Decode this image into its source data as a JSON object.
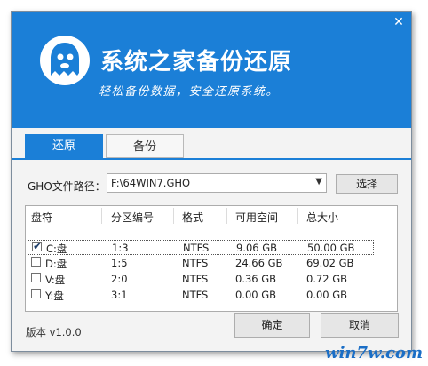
{
  "header": {
    "title": "系统之家备份还原",
    "subtitle": "轻松备份数据，安全还原系统。"
  },
  "tabs": [
    {
      "label": "还原",
      "active": true
    },
    {
      "label": "备份",
      "active": false
    }
  ],
  "path": {
    "label": "GHO文件路径：",
    "value": "F:\\64WIN7.GHO",
    "select_button": "选择"
  },
  "table": {
    "headers": [
      "盘符",
      "分区编号",
      "格式",
      "可用空间",
      "总大小"
    ],
    "rows": [
      {
        "drive": "C:盘",
        "partition": "1:3",
        "format": "NTFS",
        "free": "9.06 GB",
        "total": "50.00 GB",
        "checked": true
      },
      {
        "drive": "D:盘",
        "partition": "1:5",
        "format": "NTFS",
        "free": "24.66 GB",
        "total": "69.02 GB",
        "checked": false
      },
      {
        "drive": "V:盘",
        "partition": "2:0",
        "format": "NTFS",
        "free": "0.36 GB",
        "total": "0.72 GB",
        "checked": false
      },
      {
        "drive": "Y:盘",
        "partition": "3:1",
        "format": "NTFS",
        "free": "0.00 GB",
        "total": "0.00 GB",
        "checked": false
      }
    ]
  },
  "footer": {
    "version": "版本 v1.0.0",
    "ok_label": "确定",
    "cancel_label": "取消"
  },
  "watermark": "win7w.com",
  "colors": {
    "accent": "#1b7fd7",
    "watermark": "#1a6ec6"
  },
  "icons": {
    "logo": "ghost-icon",
    "close": "close-icon",
    "dropdown": "chevron-down-icon",
    "check": "check-icon"
  }
}
